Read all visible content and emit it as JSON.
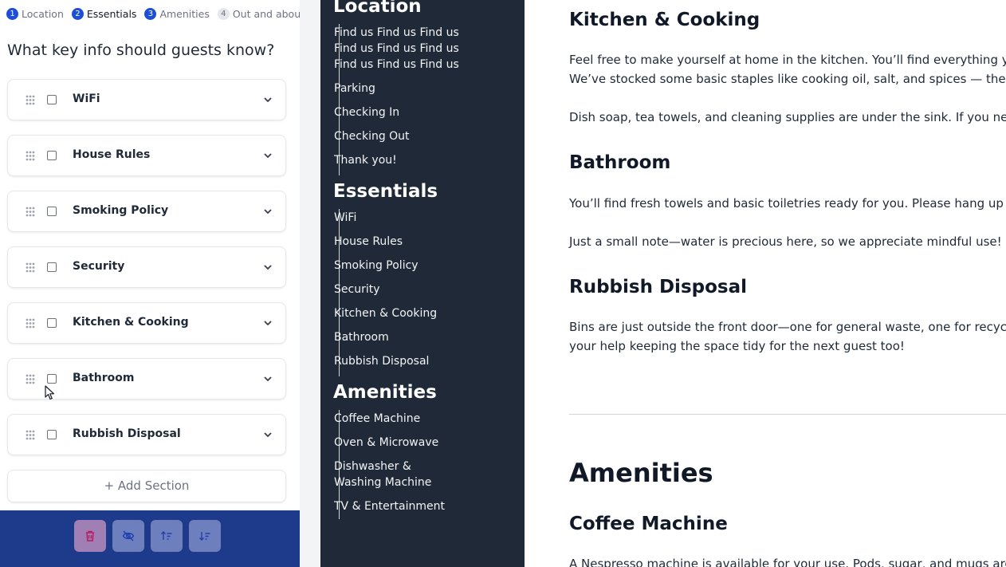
{
  "steps": [
    {
      "num": "1",
      "label": "Location"
    },
    {
      "num": "2",
      "label": "Essentials"
    },
    {
      "num": "3",
      "label": "Amenities"
    },
    {
      "num": "4",
      "label": "Out and about"
    }
  ],
  "question": "What key info should guests know?",
  "sections": [
    {
      "title": "WiFi"
    },
    {
      "title": "House Rules"
    },
    {
      "title": "Smoking Policy"
    },
    {
      "title": "Security"
    },
    {
      "title": "Kitchen & Cooking"
    },
    {
      "title": "Bathroom"
    },
    {
      "title": "Rubbish Disposal"
    }
  ],
  "add_section_label": "+ Add Section",
  "toolbar": {
    "icons": [
      "trash-icon",
      "eye-off-icon",
      "sort-ascending-icon",
      "sort-descending-icon"
    ]
  },
  "nav": {
    "location": {
      "heading": "Location",
      "items": [
        "Find us Find us Find us Find us Find us Find us Find us Find us Find us",
        "Parking",
        "Checking In",
        "Checking Out",
        "Thank you!"
      ]
    },
    "essentials": {
      "heading": "Essentials",
      "items": [
        "WiFi",
        "House Rules",
        "Smoking Policy",
        "Security",
        "Kitchen & Cooking",
        "Bathroom",
        "Rubbish Disposal"
      ]
    },
    "amenities": {
      "heading": "Amenities",
      "items": [
        "Coffee Machine",
        "Oven & Microwave",
        "Dishwasher & Washing Machine",
        "TV & Entertainment"
      ]
    }
  },
  "preview": {
    "kitchen_heading": "Kitchen & Cooking",
    "kitchen_p1_l1": "Feel free to make yourself at home in the kitchen. You’ll find everything you",
    "kitchen_p1_l2": "We’ve stocked some basic staples like cooking oil, salt, and spices — these",
    "kitchen_p2": "Dish soap, tea towels, and cleaning supplies are under the sink. If you need",
    "bathroom_heading": "Bathroom",
    "bathroom_p1": "You’ll find fresh towels and basic toiletries ready for you. Please hang up us",
    "bathroom_p2": "Just a small note—water is precious here, so we appreciate mindful use!",
    "rubbish_heading": "Rubbish Disposal",
    "rubbish_p1_l1": "Bins are just outside the front door—one for general waste, one for recyclin",
    "rubbish_p1_l2": "your help keeping the space tidy for the next guest too!",
    "amenities_heading": "Amenities",
    "coffee_heading": "Coffee Machine",
    "coffee_p1": "A Nespresso machine is available for your use. Pods, sugar, and mugs are in"
  },
  "colors": {
    "accent": "#1d4ed8",
    "toolbar": "#1e3a8a",
    "sidebar": "#1f2937"
  }
}
